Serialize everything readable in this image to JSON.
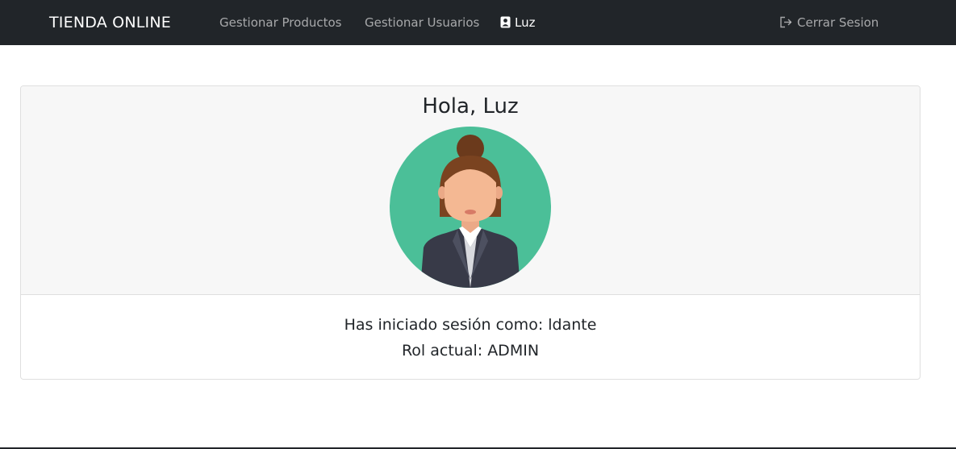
{
  "navbar": {
    "brand": "TIENDA ONLINE",
    "links": [
      {
        "label": "Gestionar Productos"
      },
      {
        "label": "Gestionar Usuarios"
      },
      {
        "label": "Luz",
        "icon": "user-badge-icon"
      }
    ],
    "logout": {
      "label": "Cerrar Sesion",
      "icon": "sign-out-icon"
    }
  },
  "profile": {
    "greeting": "Hola, Luz",
    "avatar": "female-avatar",
    "logged_in_as": "Has iniciado sesión como: ldante",
    "role": "Rol actual: ADMIN"
  },
  "colors": {
    "navbar_bg": "#212529",
    "avatar_bg": "#4bbf98",
    "card_header_bg": "#f7f7f7"
  }
}
